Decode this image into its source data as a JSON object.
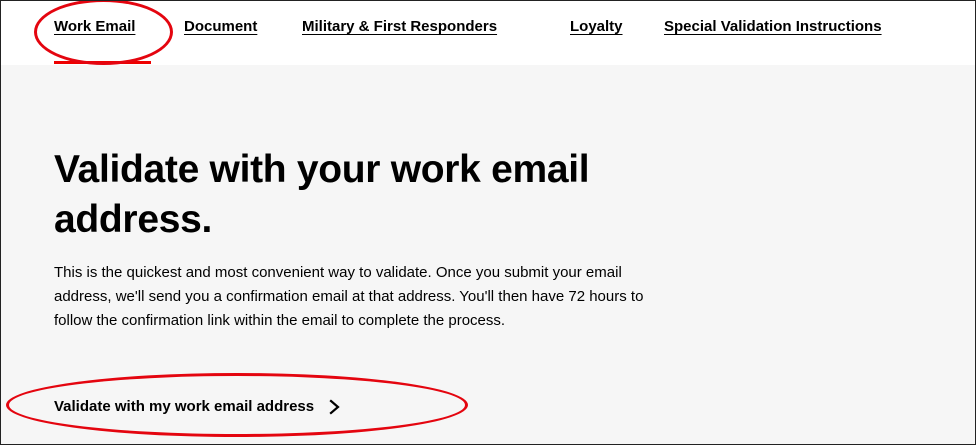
{
  "tabs": [
    {
      "label": "Work Email",
      "active": true
    },
    {
      "label": "Document",
      "active": false
    },
    {
      "label": "Military & First Responders",
      "active": false
    },
    {
      "label": "Loyalty",
      "active": false
    },
    {
      "label": "Special Validation Instructions",
      "active": false
    }
  ],
  "main": {
    "headline": "Validate with your work email address.",
    "body": "This is the quickest and most convenient way to validate. Once you submit your email address, we'll send you a confirmation email at that address. You'll then have 72 hours to follow the confirmation link within the email to complete the process.",
    "cta_label": "Validate with my work email address"
  },
  "colors": {
    "accent": "#ee0000",
    "annotation": "#e4050f",
    "content_bg": "#f6f6f6"
  },
  "icons": {
    "cta_icon": "chevron-right-icon"
  }
}
